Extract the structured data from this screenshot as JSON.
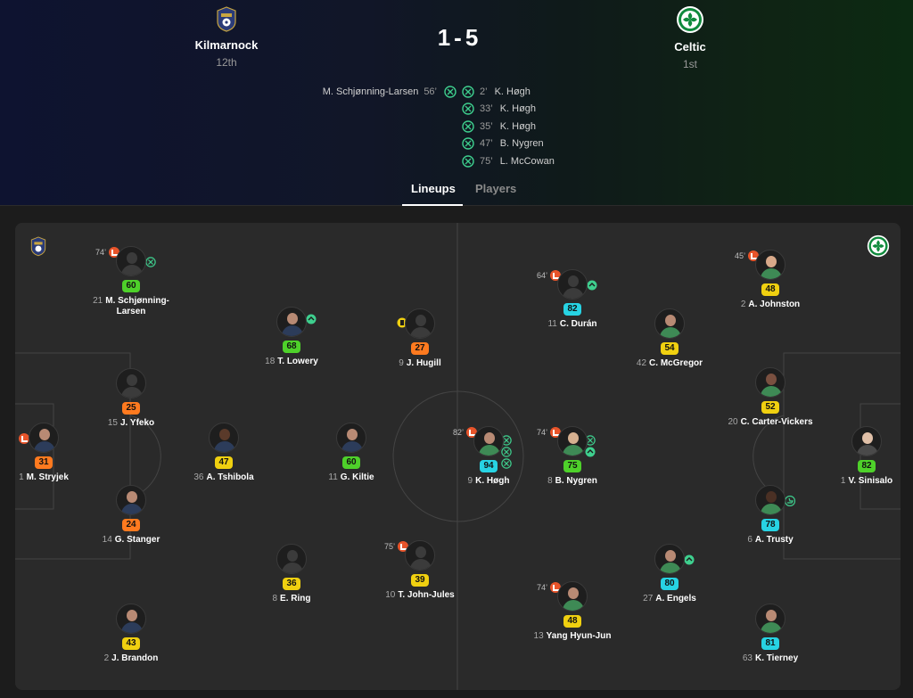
{
  "match": {
    "home": {
      "name": "Kilmarnock",
      "position": "12th"
    },
    "away": {
      "name": "Celtic",
      "position": "1st"
    },
    "score_home": "1",
    "score_away": "5",
    "score_sep": "-"
  },
  "scorers": {
    "home": [
      {
        "player": "M. Schjønning-Larsen",
        "minute": "56’"
      }
    ],
    "away": [
      {
        "minute": "2’",
        "player": "K. Høgh"
      },
      {
        "minute": "33’",
        "player": "K. Høgh"
      },
      {
        "minute": "35’",
        "player": "K. Høgh"
      },
      {
        "minute": "47’",
        "player": "B. Nygren"
      },
      {
        "minute": "75’",
        "player": "L. McCowan"
      }
    ]
  },
  "tabs": [
    {
      "label": "Lineups"
    },
    {
      "label": "Players"
    }
  ],
  "colors": {
    "rating_blue": "#27d3e3",
    "rating_green": "#4ed12a",
    "rating_yellow": "#f0d010",
    "rating_orange": "#ff7a1f",
    "sub_icon": "#e8542a",
    "goal_icon": "#3ecf8e"
  },
  "players": [
    {
      "id": "schjonning",
      "number": "21",
      "name": "M. Schjønning-Larsen",
      "rating": "60",
      "sub_minute": "74’"
    },
    {
      "id": "stryjek",
      "number": "1",
      "name": "M. Stryjek",
      "rating": "31"
    },
    {
      "id": "yfeko",
      "number": "15",
      "name": "J. Yfeko",
      "rating": "25"
    },
    {
      "id": "stanger",
      "number": "14",
      "name": "G. Stanger",
      "rating": "24"
    },
    {
      "id": "brandon",
      "number": "2",
      "name": "J. Brandon",
      "rating": "43"
    },
    {
      "id": "lowery",
      "number": "18",
      "name": "T. Lowery",
      "rating": "68"
    },
    {
      "id": "tshibola",
      "number": "36",
      "name": "A. Tshibola",
      "rating": "47"
    },
    {
      "id": "ring",
      "number": "8",
      "name": "E. Ring",
      "rating": "36"
    },
    {
      "id": "hugill",
      "number": "9",
      "name": "J. Hugill",
      "rating": "27"
    },
    {
      "id": "kiltie",
      "number": "11",
      "name": "G. Kiltie",
      "rating": "60"
    },
    {
      "id": "johnjules",
      "number": "10",
      "name": "T. John-Jules",
      "rating": "39",
      "sub_minute": "75’"
    },
    {
      "id": "duran",
      "number": "11",
      "name": "C. Durán",
      "rating": "82",
      "sub_minute": "64’"
    },
    {
      "id": "hogh",
      "number": "9",
      "name": "K. Høgh",
      "rating": "94",
      "sub_minute": "82’"
    },
    {
      "id": "yang",
      "number": "13",
      "name": "Yang Hyun-Jun",
      "rating": "48",
      "sub_minute": "74’"
    },
    {
      "id": "mcgregor",
      "number": "42",
      "name": "C. McGregor",
      "rating": "54"
    },
    {
      "id": "nygren",
      "number": "8",
      "name": "B. Nygren",
      "rating": "75",
      "sub_minute": "74’"
    },
    {
      "id": "engels",
      "number": "27",
      "name": "A. Engels",
      "rating": "80"
    },
    {
      "id": "johnston",
      "number": "2",
      "name": "A. Johnston",
      "rating": "48",
      "sub_minute": "45’"
    },
    {
      "id": "cartervickers",
      "number": "20",
      "name": "C. Carter-Vickers",
      "rating": "52"
    },
    {
      "id": "trusty",
      "number": "6",
      "name": "A. Trusty",
      "rating": "78"
    },
    {
      "id": "tierney",
      "number": "63",
      "name": "K. Tierney",
      "rating": "81"
    },
    {
      "id": "sinisalo",
      "number": "1",
      "name": "V. Sinisalo",
      "rating": "82"
    }
  ]
}
